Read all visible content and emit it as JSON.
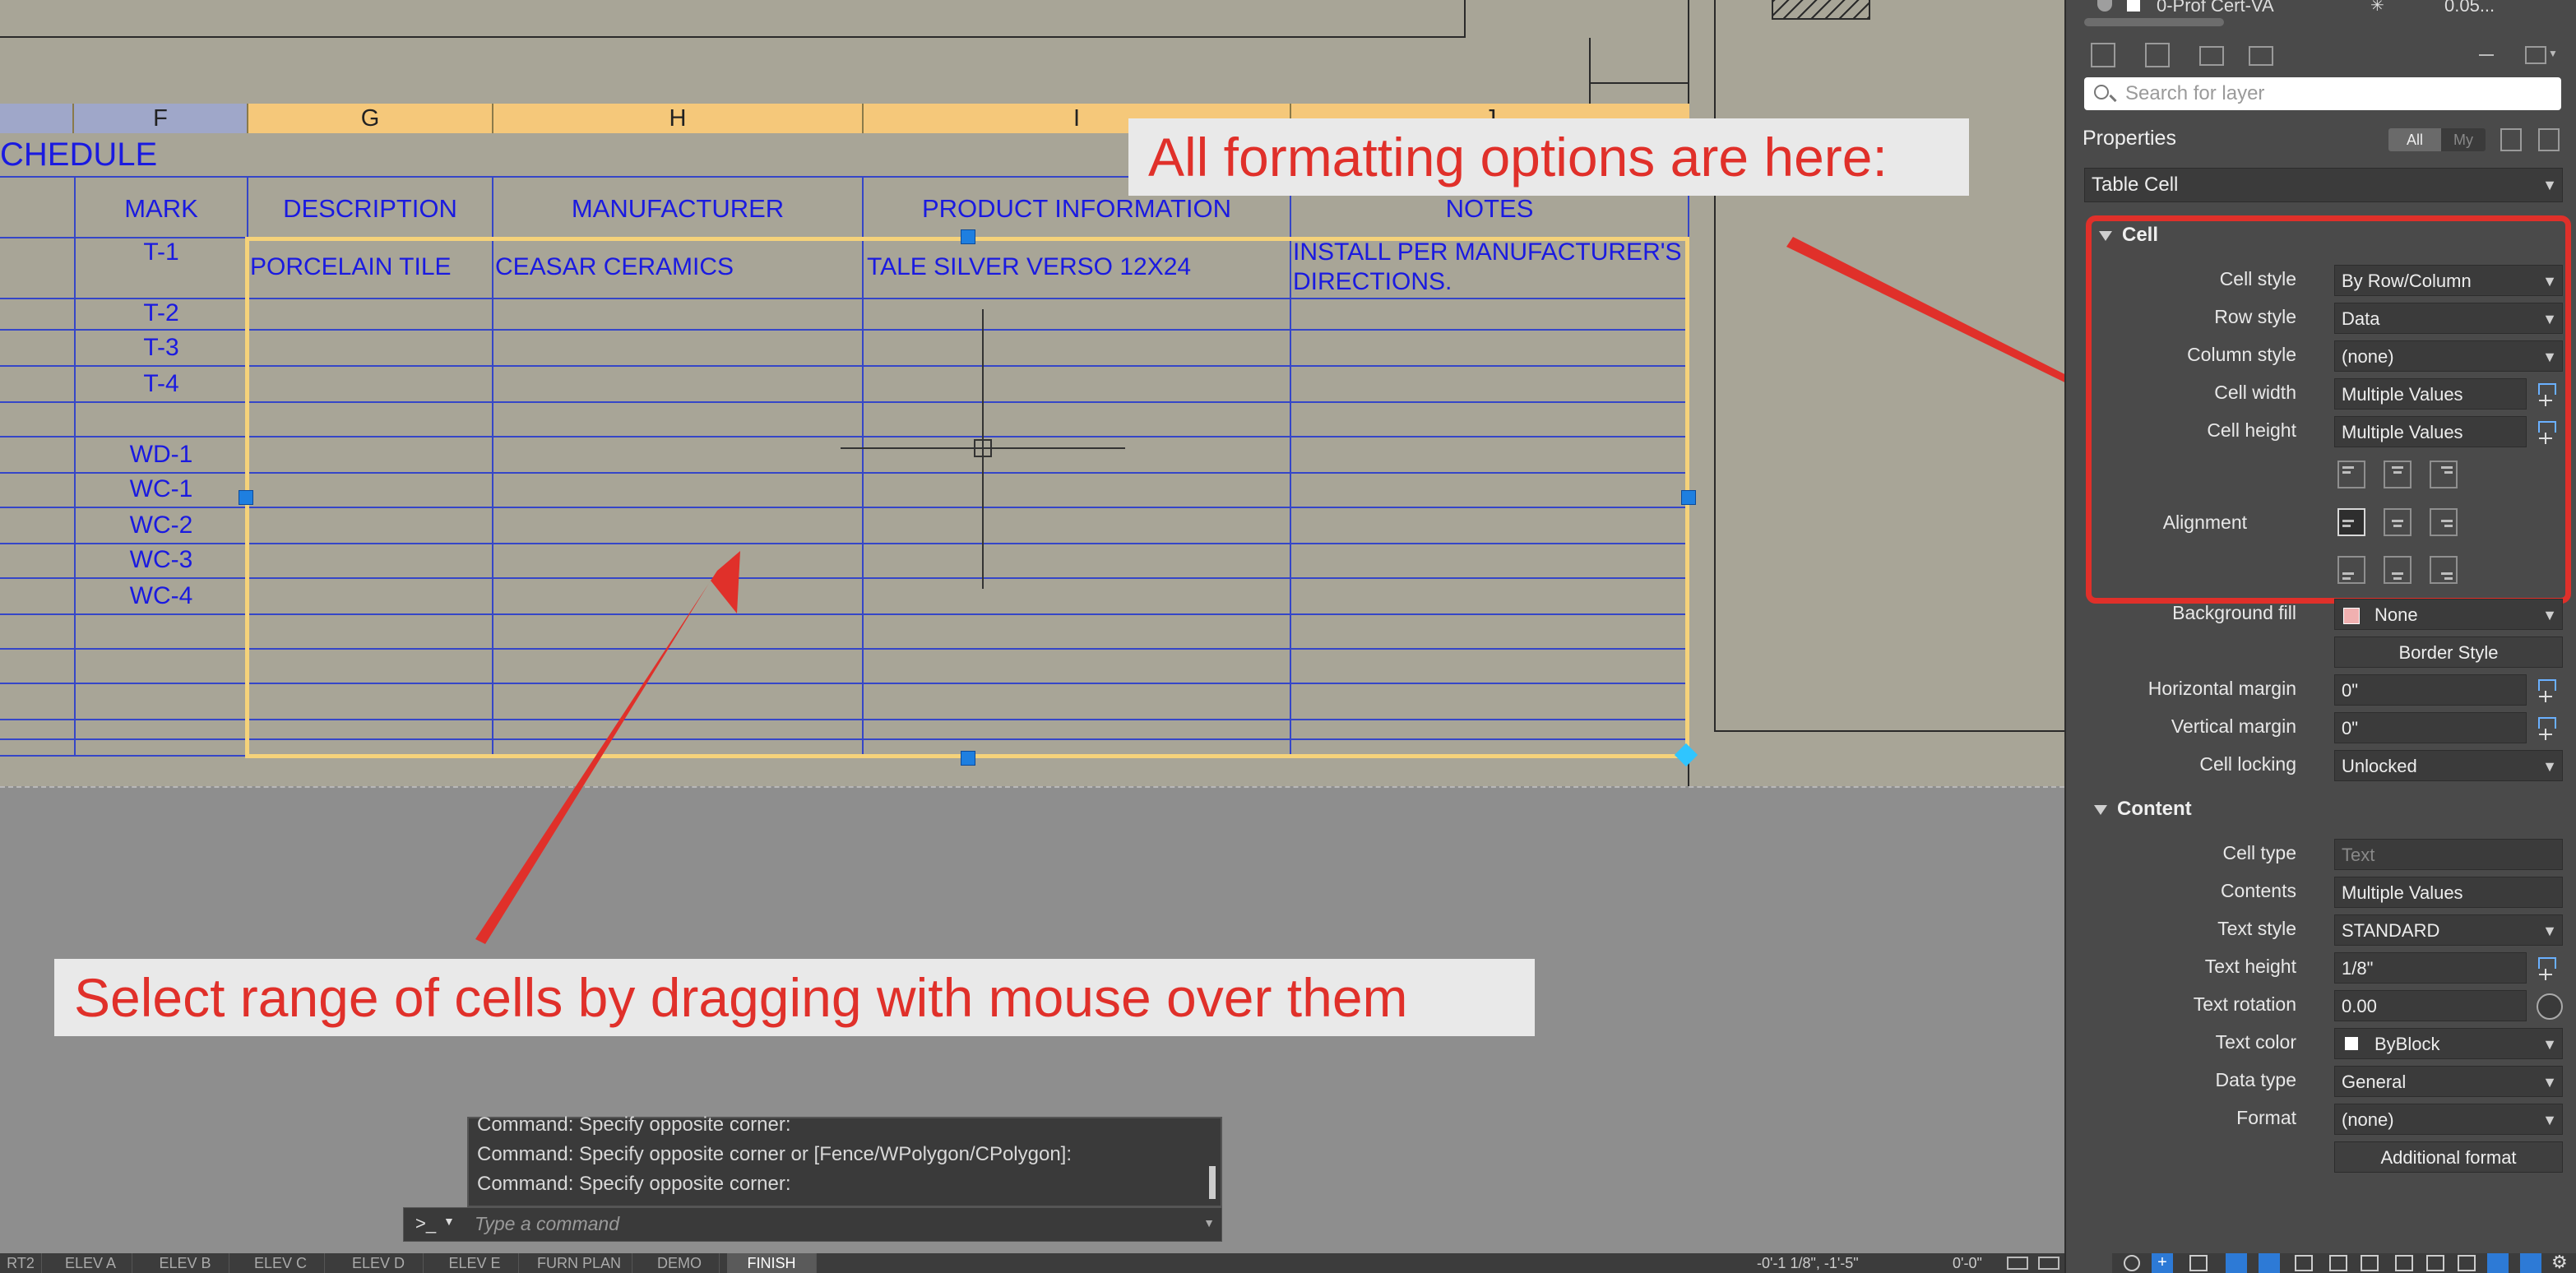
{
  "table": {
    "columns": [
      "F",
      "G",
      "H",
      "I",
      "J"
    ],
    "title": "CHEDULE",
    "headers": [
      "MARK",
      "DESCRIPTION",
      "MANUFACTURER",
      "PRODUCT INFORMATION",
      "NOTES"
    ],
    "marks": [
      "T-1",
      "T-2",
      "T-3",
      "T-4",
      "WD-1",
      "WC-1",
      "WC-2",
      "WC-3",
      "WC-4"
    ],
    "row1": {
      "description": "PORCELAIN TILE",
      "manufacturer": "CEASAR CERAMICS",
      "product": "TALE SILVER VERSO 12X24",
      "notes_line1": "INSTALL PER MANUFACTURER'S",
      "notes_line2": "DIRECTIONS."
    }
  },
  "callouts": {
    "top": "All formatting options are here:",
    "bottom": "Select range of cells by dragging with mouse over them"
  },
  "command": {
    "history": [
      "Command: Specify opposite corner:",
      "Command: Specify opposite corner or [Fence/WPolygon/CPolygon]:",
      "Command: Specify opposite corner:"
    ],
    "prompt_symbol": ">_",
    "placeholder": "Type a command"
  },
  "layout_tabs": [
    "RT2",
    "ELEV A",
    "ELEV B",
    "ELEV C",
    "ELEV D",
    "ELEV E",
    "FURN PLAN",
    "DEMO",
    "FINISH"
  ],
  "status": {
    "coordinates": "-0'-1 1/8\", -1'-5\"",
    "z": "0'-0\""
  },
  "palette": {
    "layer_top_name": "0-Prof Cert-VA",
    "layer_top_value": "0.05...",
    "search_placeholder": "Search for layer",
    "title": "Properties",
    "toggle_all": "All",
    "toggle_my": "My",
    "object_type": "Table Cell",
    "cell_section": "Cell",
    "cell_props": [
      {
        "label": "Cell style",
        "value": "By Row/Column",
        "kind": "dropdown"
      },
      {
        "label": "Row style",
        "value": "Data",
        "kind": "dropdown"
      },
      {
        "label": "Column style",
        "value": "(none)",
        "kind": "dropdown"
      },
      {
        "label": "Cell width",
        "value": "Multiple Values",
        "kind": "pick"
      },
      {
        "label": "Cell height",
        "value": "Multiple Values",
        "kind": "pick"
      }
    ],
    "alignment_label": "Alignment",
    "background_fill_label": "Background fill",
    "background_fill_value": "None",
    "border_style_button": "Border Style",
    "horizontal_margin_label": "Horizontal margin",
    "horizontal_margin_value": "0\"",
    "vertical_margin_label": "Vertical margin",
    "vertical_margin_value": "0\"",
    "cell_locking_label": "Cell locking",
    "cell_locking_value": "Unlocked",
    "content_section": "Content",
    "content_props": [
      {
        "label": "Cell type",
        "value": "Text",
        "kind": "disabled"
      },
      {
        "label": "Contents",
        "value": "Multiple Values",
        "kind": "text"
      },
      {
        "label": "Text style",
        "value": "STANDARD",
        "kind": "dropdown"
      },
      {
        "label": "Text height",
        "value": "1/8\"",
        "kind": "pick"
      },
      {
        "label": "Text rotation",
        "value": "0.00",
        "kind": "rotate"
      },
      {
        "label": "Text color",
        "value": "ByBlock",
        "kind": "color"
      },
      {
        "label": "Data type",
        "value": "General",
        "kind": "dropdown"
      },
      {
        "label": "Format",
        "value": "(none)",
        "kind": "dropdown"
      }
    ],
    "additional_format_button": "Additional format"
  },
  "colors": {
    "highlight_red": "#e0302a",
    "table_blue": "#1a1ae0",
    "selection_yellow": "#f5d27a",
    "grip_blue": "#1e7fe0"
  }
}
